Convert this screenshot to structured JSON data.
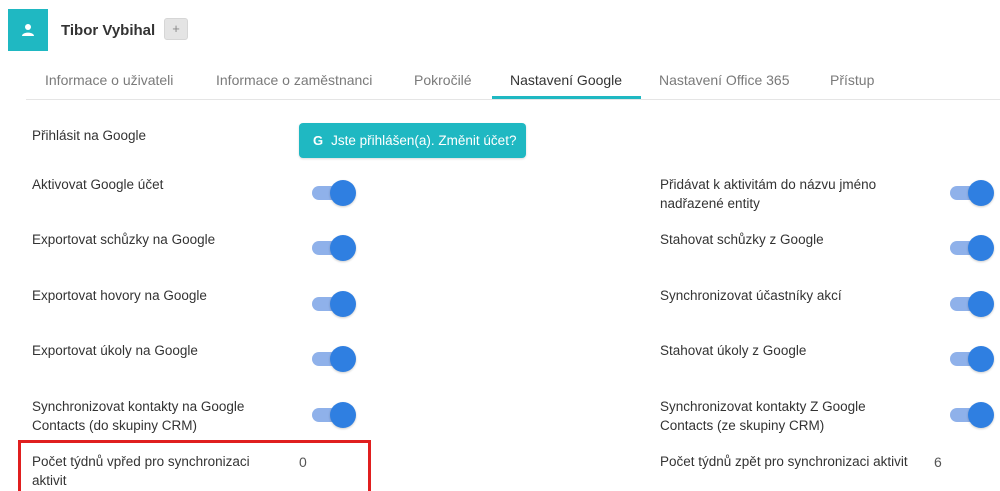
{
  "user": {
    "name": "Tibor Vybihal",
    "add_label": "+",
    "avatar_icon": "user-icon"
  },
  "tabs": [
    {
      "label": "Informace o uživateli"
    },
    {
      "label": "Informace o zaměstnanci"
    },
    {
      "label": "Pokročilé"
    },
    {
      "label": "Nastavení Google"
    },
    {
      "label": "Nastavení Office 365"
    },
    {
      "label": "Přístup"
    }
  ],
  "active_tab": "Nastavení Google",
  "settings": {
    "login_label": "Přihlásit na Google",
    "google_button": {
      "icon_letter": "G",
      "label": "Jste přihlášen(a). Změnit účet?"
    },
    "left": [
      {
        "label": "Aktivovat Google účet",
        "enabled": true
      },
      {
        "label": "Exportovat schůzky na Google",
        "enabled": true
      },
      {
        "label": "Exportovat hovory na Google",
        "enabled": true
      },
      {
        "label": "Exportovat úkoly na Google",
        "enabled": true
      },
      {
        "label": "Synchronizovat kontakty na Google Contacts (do skupiny CRM)",
        "enabled": true
      }
    ],
    "right": [
      {
        "label": "Přidávat k aktivitám do názvu jméno nadřazené entity",
        "enabled": true
      },
      {
        "label": "Stahovat schůzky z Google",
        "enabled": true
      },
      {
        "label": "Synchronizovat účastníky akcí",
        "enabled": true
      },
      {
        "label": "Stahovat úkoly z Google",
        "enabled": true
      },
      {
        "label": "Synchronizovat kontakty Z Google Contacts (ze skupiny CRM)",
        "enabled": true
      }
    ],
    "weeks_forward": {
      "label": "Počet týdnů vpřed pro synchronizaci aktivit",
      "value": "0"
    },
    "weeks_back": {
      "label": "Počet týdnů zpět pro synchronizaci aktivit",
      "value": "6"
    }
  },
  "colors": {
    "accent": "#1fb8c2",
    "toggle_on": "#2f7fe1",
    "highlight": "#e01f1f"
  }
}
